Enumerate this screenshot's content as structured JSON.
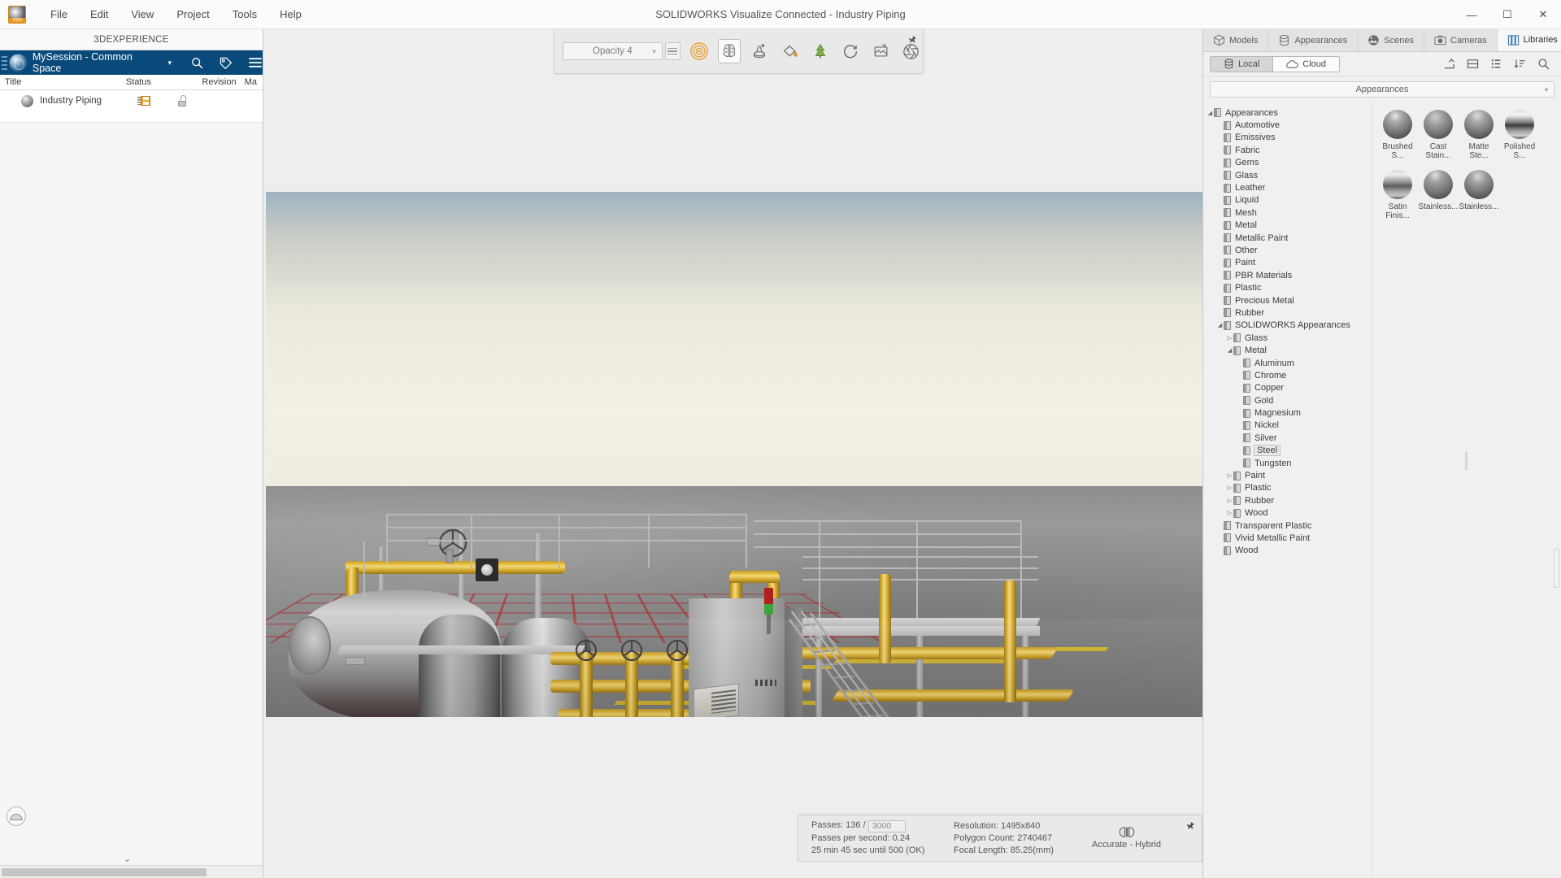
{
  "window": {
    "title": "SOLIDWORKS Visualize Connected - Industry Piping",
    "minimize": "—",
    "maximize": "☐",
    "close": "✕"
  },
  "menu": {
    "items": [
      {
        "label": "File"
      },
      {
        "label": "Edit"
      },
      {
        "label": "View"
      },
      {
        "label": "Project"
      },
      {
        "label": "Tools"
      },
      {
        "label": "Help"
      }
    ]
  },
  "left_panel": {
    "experience_label": "3DEXPERIENCE",
    "session": {
      "title": "MySession - Common Space",
      "caret": "▾"
    },
    "table": {
      "columns": [
        "Title",
        "Status",
        "",
        "Revision",
        "Ma"
      ],
      "rows": [
        {
          "title": "Industry Piping",
          "status": "saved",
          "lock": "unlocked",
          "revision": "",
          "maturity": ""
        }
      ]
    }
  },
  "toolbar": {
    "opacity_label": "Opacity 4",
    "opacity_caret": "▾",
    "icons": [
      {
        "name": "list-view-icon"
      },
      {
        "name": "target-rings-icon"
      },
      {
        "name": "brain-icon"
      },
      {
        "name": "stamp-icon"
      },
      {
        "name": "paint-bucket-icon"
      },
      {
        "name": "tree-decal-icon"
      },
      {
        "name": "rotate-icon"
      },
      {
        "name": "export-image-icon"
      },
      {
        "name": "camera-aperture-icon"
      }
    ],
    "pin": "pin-icon"
  },
  "status": {
    "passes_label": "Passes: 136 /",
    "passes_total": "3000",
    "passes_per_second": "Passes per second: 0.24",
    "eta": "25 min 45 sec until 500 (OK)",
    "resolution": "Resolution: 1495x840",
    "polygon_count": "Polygon Count: 2740467",
    "focal_length": "Focal Length: 85.25(mm)",
    "render_mode": "Accurate - Hybrid",
    "pin": "pin-icon"
  },
  "right_panel": {
    "tabs": [
      {
        "label": "Models",
        "icon": "cube-icon",
        "active": false
      },
      {
        "label": "Appearances",
        "icon": "cylinder-icon",
        "active": false
      },
      {
        "label": "Scenes",
        "icon": "image-sphere-icon",
        "active": false
      },
      {
        "label": "Cameras",
        "icon": "camera-icon",
        "active": false
      },
      {
        "label": "Libraries",
        "icon": "books-icon",
        "active": true
      }
    ],
    "source_toggle": [
      {
        "label": "Local",
        "icon": "database-icon",
        "selected": true
      },
      {
        "label": "Cloud",
        "icon": "cloud-icon",
        "selected": false
      }
    ],
    "sub_icons": [
      {
        "name": "import-arrow-icon"
      },
      {
        "name": "split-view-icon"
      },
      {
        "name": "grid-view-icon"
      },
      {
        "name": "sort-icon"
      },
      {
        "name": "search-icon"
      }
    ],
    "category_combo": {
      "value": "Appearances",
      "caret": "▾"
    },
    "tree": [
      {
        "label": "Appearances",
        "depth": 0,
        "arrow": "◢",
        "expanded": true
      },
      {
        "label": "Automotive",
        "depth": 1,
        "arrow": ""
      },
      {
        "label": "Emissives",
        "depth": 1,
        "arrow": ""
      },
      {
        "label": "Fabric",
        "depth": 1,
        "arrow": ""
      },
      {
        "label": "Gems",
        "depth": 1,
        "arrow": ""
      },
      {
        "label": "Glass",
        "depth": 1,
        "arrow": ""
      },
      {
        "label": "Leather",
        "depth": 1,
        "arrow": ""
      },
      {
        "label": "Liquid",
        "depth": 1,
        "arrow": ""
      },
      {
        "label": "Mesh",
        "depth": 1,
        "arrow": ""
      },
      {
        "label": "Metal",
        "depth": 1,
        "arrow": ""
      },
      {
        "label": "Metallic Paint",
        "depth": 1,
        "arrow": ""
      },
      {
        "label": "Other",
        "depth": 1,
        "arrow": ""
      },
      {
        "label": "Paint",
        "depth": 1,
        "arrow": ""
      },
      {
        "label": "PBR Materials",
        "depth": 1,
        "arrow": ""
      },
      {
        "label": "Plastic",
        "depth": 1,
        "arrow": ""
      },
      {
        "label": "Precious Metal",
        "depth": 1,
        "arrow": ""
      },
      {
        "label": "Rubber",
        "depth": 1,
        "arrow": ""
      },
      {
        "label": "SOLIDWORKS Appearances",
        "depth": 1,
        "arrow": "◢",
        "expanded": true
      },
      {
        "label": "Glass",
        "depth": 2,
        "arrow": "▷"
      },
      {
        "label": "Metal",
        "depth": 2,
        "arrow": "◢",
        "expanded": true
      },
      {
        "label": "Aluminum",
        "depth": 3,
        "arrow": ""
      },
      {
        "label": "Chrome",
        "depth": 3,
        "arrow": ""
      },
      {
        "label": "Copper",
        "depth": 3,
        "arrow": ""
      },
      {
        "label": "Gold",
        "depth": 3,
        "arrow": ""
      },
      {
        "label": "Magnesium",
        "depth": 3,
        "arrow": ""
      },
      {
        "label": "Nickel",
        "depth": 3,
        "arrow": ""
      },
      {
        "label": "Silver",
        "depth": 3,
        "arrow": ""
      },
      {
        "label": "Steel",
        "depth": 3,
        "arrow": "",
        "selected": true
      },
      {
        "label": "Tungsten",
        "depth": 3,
        "arrow": ""
      },
      {
        "label": "Paint",
        "depth": 2,
        "arrow": "▷"
      },
      {
        "label": "Plastic",
        "depth": 2,
        "arrow": "▷"
      },
      {
        "label": "Rubber",
        "depth": 2,
        "arrow": "▷"
      },
      {
        "label": "Wood",
        "depth": 2,
        "arrow": "▷"
      },
      {
        "label": "Transparent Plastic",
        "depth": 1,
        "arrow": ""
      },
      {
        "label": "Vivid Metallic Paint",
        "depth": 1,
        "arrow": ""
      },
      {
        "label": "Wood",
        "depth": 1,
        "arrow": ""
      }
    ],
    "materials": [
      {
        "label": "Brushed S...",
        "style": "sph-brushed"
      },
      {
        "label": "Cast Stain...",
        "style": "sph-cast"
      },
      {
        "label": "Matte Ste...",
        "style": "sph-matte"
      },
      {
        "label": "Polished S...",
        "style": "sph-polish"
      },
      {
        "label": "Satin Finis...",
        "style": "sph-satin"
      },
      {
        "label": "Stainless...",
        "style": "sph-st1"
      },
      {
        "label": "Stainless...",
        "style": "sph-st2"
      }
    ]
  },
  "colors": {
    "session_blue": "#0a4a7a",
    "accent_orange": "#e8a33d",
    "pipe_yellow": "#e0bb41",
    "floor_red": "#af1e1e",
    "floor_yellow": "#d8b829"
  }
}
